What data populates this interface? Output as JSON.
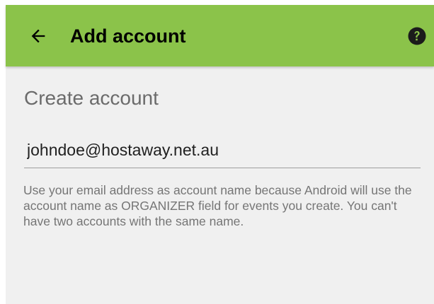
{
  "colors": {
    "app_bar": "#8bc34a",
    "background": "#f0f0f0",
    "title_text": "#000000",
    "section_title": "#6b6b6b",
    "hint_text": "#757575"
  },
  "app_bar": {
    "back_icon": "arrow-left-icon",
    "title": "Add account",
    "help_icon": "help-circle-icon"
  },
  "form": {
    "section_title": "Create account",
    "account_name_value": "johndoe@hostaway.net.au",
    "hint": "Use your email address as account name because Android will use the account name as ORGANIZER field for events you create. You can't have two accounts with the same name."
  }
}
